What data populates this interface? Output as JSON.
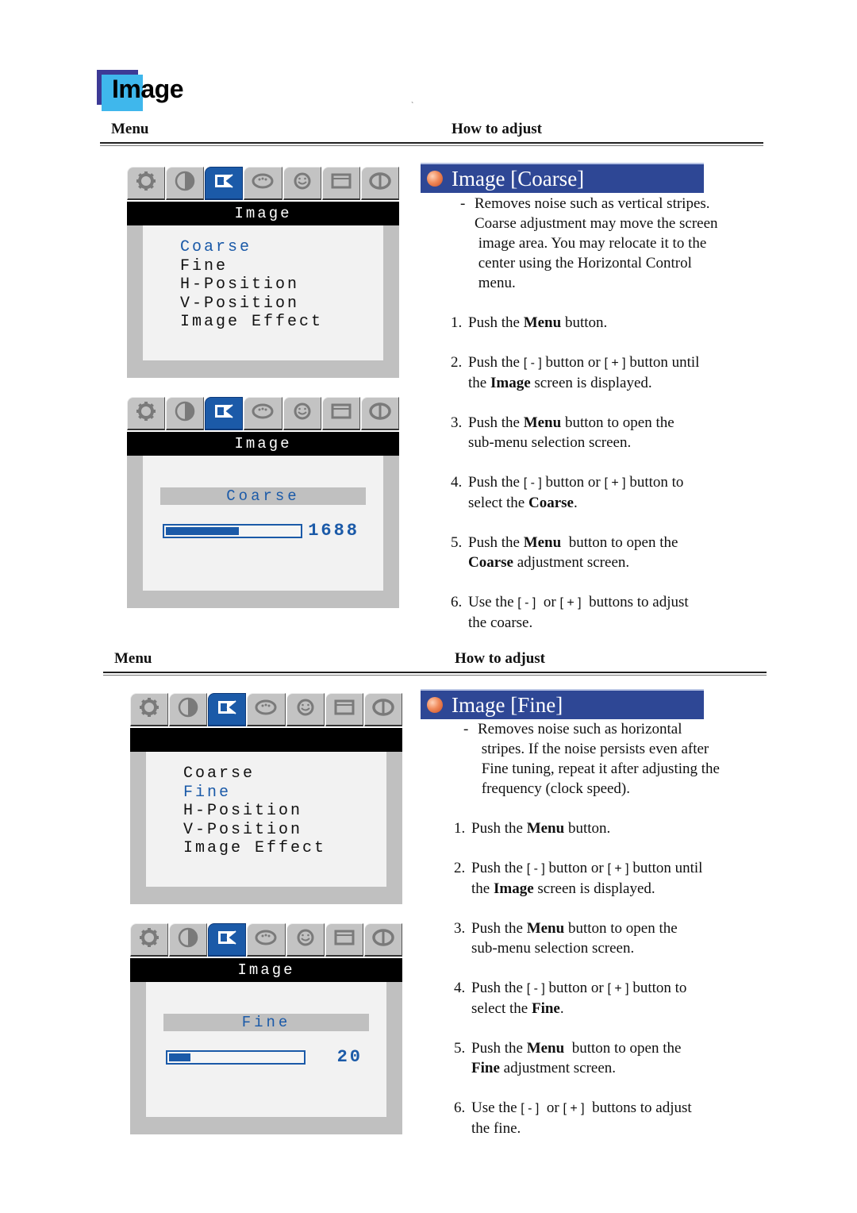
{
  "page": {
    "title": "Image",
    "stray_mark": "`"
  },
  "section_headers": [
    {
      "menu_label": "Menu",
      "how_label": "How to adjust"
    },
    {
      "menu_label": "Menu",
      "how_label": "How to adjust"
    }
  ],
  "osd_tab_icons": [
    "gear-icon",
    "contrast-half-circle-icon",
    "image-icon",
    "palette-icon",
    "face-icon",
    "window-frame-icon",
    "info-circle-icon"
  ],
  "osd_colors": {
    "accent": "#1b5aa8",
    "frame": "#c0c0c0",
    "panel": "#f2f2f2",
    "titlebar": "#000000"
  },
  "osd_screens": [
    {
      "title": "Image",
      "type": "menu",
      "selected_tab": 2,
      "items": [
        "Coarse",
        "Fine",
        "H-Position",
        "V-Position",
        "Image Effect"
      ],
      "selected_item": 0
    },
    {
      "title": "Image",
      "type": "adjust",
      "selected_tab": 2,
      "label": "Coarse",
      "value": "1688",
      "bar_fraction": 0.55
    },
    {
      "title": "",
      "type": "menu",
      "selected_tab": 2,
      "items": [
        "Coarse",
        "Fine",
        "H-Position",
        "V-Position",
        "Image Effect"
      ],
      "selected_item": 1
    },
    {
      "title": "Image",
      "type": "adjust",
      "selected_tab": 2,
      "label": "Fine",
      "value": "20",
      "bar_fraction": 0.16
    }
  ],
  "sections": [
    {
      "heading": "Image [Coarse]",
      "description_dash": "-",
      "description_lines": [
        "Removes noise such as vertical stripes.",
        "Coarse adjustment may move the screen",
        " image area. You may relocate it to the",
        " center using the Horizontal Control",
        " menu."
      ],
      "steps": [
        {
          "num": "1.",
          "parts": [
            "Push the ",
            "Menu",
            " button."
          ]
        },
        {
          "num": "2.",
          "parts": [
            "Push the ",
            "[ - ]",
            " button or ",
            "[ + ]",
            " button until",
            "the ",
            "Image",
            " screen is displayed."
          ]
        },
        {
          "num": "3.",
          "parts": [
            "Push the ",
            "Menu",
            " button to open the",
            "sub-menu selection screen."
          ]
        },
        {
          "num": "4.",
          "parts": [
            "Push the ",
            "[ - ]",
            " button or ",
            "[ + ]",
            " button to",
            "select the ",
            "Coarse",
            "."
          ]
        },
        {
          "num": "5.",
          "parts": [
            "Push the ",
            "Menu",
            "  button to open the",
            "Coarse",
            " adjustment screen."
          ]
        },
        {
          "num": "6.",
          "parts": [
            "Use the ",
            "[ - ]",
            "  or ",
            "[ + ]",
            "  buttons to adjust",
            "the coarse."
          ]
        }
      ]
    },
    {
      "heading": "Image [Fine]",
      "description_dash": "-",
      "description_lines": [
        "Removes noise such as horizontal",
        " stripes. If the noise persists even after",
        " Fine tuning, repeat it after adjusting the",
        " frequency (clock speed)."
      ],
      "steps": [
        {
          "num": "1.",
          "parts": [
            "Push the ",
            "Menu",
            " button."
          ]
        },
        {
          "num": "2.",
          "parts": [
            "Push the ",
            "[ - ]",
            " button or ",
            "[ + ]",
            " button until",
            "the ",
            "Image",
            " screen is displayed."
          ]
        },
        {
          "num": "3.",
          "parts": [
            "Push the ",
            "Menu",
            " button to open the",
            "sub-menu selection screen."
          ]
        },
        {
          "num": "4.",
          "parts": [
            "Push the ",
            "[ - ]",
            " button or ",
            "[ + ]",
            " button to",
            "select the ",
            "Fine",
            "."
          ]
        },
        {
          "num": "5.",
          "parts": [
            "Push the ",
            "Menu",
            "  button to open the",
            "Fine",
            " adjustment screen."
          ]
        },
        {
          "num": "6.",
          "parts": [
            "Use the ",
            "[ - ]",
            "  or ",
            "[ + ]",
            "  buttons to adjust",
            "the fine."
          ]
        }
      ]
    }
  ]
}
